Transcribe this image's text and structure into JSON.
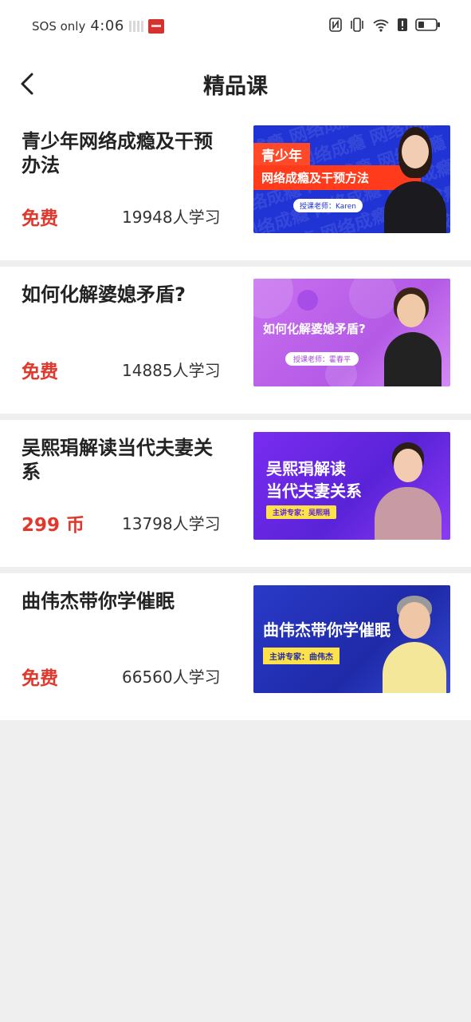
{
  "status_bar": {
    "carrier": "SOS only",
    "time": "4:06",
    "icons": [
      "nfc-icon",
      "vibrate-icon",
      "wifi-icon",
      "alert-icon",
      "battery-icon"
    ]
  },
  "header": {
    "title": "精品课",
    "back_icon": "chevron-left-icon"
  },
  "courses": [
    {
      "title": "青少年网络成瘾及干预办法",
      "price": "免费",
      "learners": "19948人学习",
      "thumb": {
        "tag": "青少年",
        "band": "网络成瘾及干预方法",
        "pill": "授课老师：Karen",
        "pattern": "网络成瘾 网络成瘾 网络成瘾"
      }
    },
    {
      "title": "如何化解婆媳矛盾?",
      "price": "免费",
      "learners": "14885人学习",
      "thumb": {
        "heading": "如何化解婆媳矛盾?",
        "pill": "授课老师：霍春平"
      }
    },
    {
      "title": "吴熙琄解读当代夫妻关系",
      "price": "299 币",
      "learners": "13798人学习",
      "thumb": {
        "line1": "吴熙琄解读",
        "line2": "当代夫妻关系",
        "pill": "主讲专家：吴熙琄"
      }
    },
    {
      "title": "曲伟杰带你学催眠",
      "price": "免费",
      "learners": "66560人学习",
      "thumb": {
        "heading": "曲伟杰带你学催眠",
        "pill": "主讲专家：曲伟杰"
      }
    }
  ],
  "colors": {
    "price": "#e2372b",
    "background": "#efefef",
    "card": "#ffffff"
  }
}
